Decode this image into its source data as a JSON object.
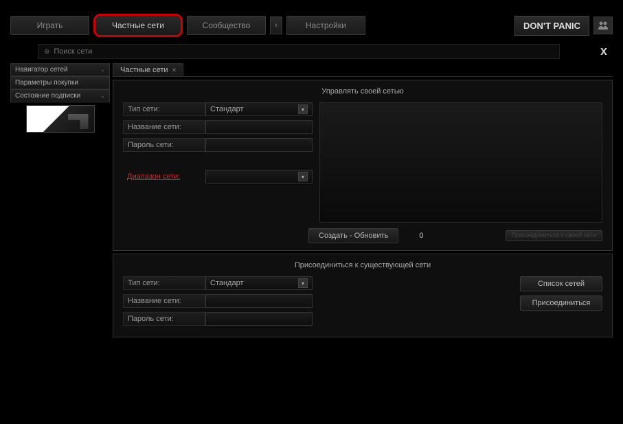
{
  "nav": {
    "play": "Играть",
    "private_nets": "Частные сети",
    "community": "Сообщество",
    "settings": "Настройки",
    "brand": "DON'T PANIC"
  },
  "search": {
    "placeholder": "Поиск сети"
  },
  "close": "x",
  "sidebar": {
    "items": [
      {
        "label": "Навигатор сетей"
      },
      {
        "label": "Параметры покупки"
      },
      {
        "label": "Состояние подписки"
      }
    ]
  },
  "tab": {
    "label": "Частные сети"
  },
  "manage": {
    "title": "Управлять своей сетью",
    "net_type_label": "Тип сети:",
    "net_type_value": "Стандарт",
    "net_name_label": "Название сети:",
    "net_name_value": "",
    "net_pass_label": "Пароль сети:",
    "net_pass_value": "",
    "range_label": "Диапазон сети:",
    "range_value": "",
    "create_update": "Создать - Обновить",
    "count": "0",
    "join_own": "Присоединиться к своей сети"
  },
  "join": {
    "title": "Присоединиться к существующей сети",
    "net_type_label": "Тип сети:",
    "net_type_value": "Стандарт",
    "net_name_label": "Название сети:",
    "net_name_value": "",
    "net_pass_label": "Пароль сети:",
    "net_pass_value": "",
    "list": "Список сетей",
    "join": "Присоединиться"
  }
}
